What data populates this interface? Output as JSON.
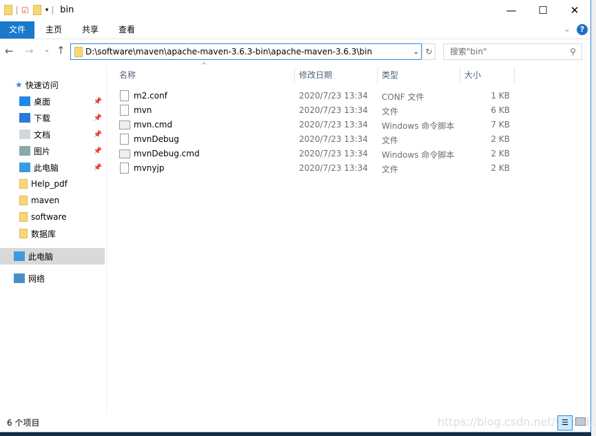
{
  "window": {
    "title": "bin"
  },
  "ribbon": {
    "tabs": [
      "文件",
      "主页",
      "共享",
      "查看"
    ]
  },
  "address": {
    "path": "D:\\software\\maven\\apache-maven-3.6.3-bin\\apache-maven-3.6.3\\bin",
    "search_placeholder": "搜索\"bin\""
  },
  "sidebar": {
    "quick_access": "快速访问",
    "items": [
      {
        "label": "桌面",
        "icon": "desktop-icon",
        "pinned": true,
        "color": "#1e88e5"
      },
      {
        "label": "下载",
        "icon": "download-icon",
        "pinned": true,
        "color": "#2a7bd5"
      },
      {
        "label": "文档",
        "icon": "document-icon",
        "pinned": true,
        "color": "#cfd8dc"
      },
      {
        "label": "图片",
        "icon": "pictures-icon",
        "pinned": true,
        "color": "#8aa"
      },
      {
        "label": "此电脑",
        "icon": "computer-icon",
        "pinned": true,
        "color": "#3b9ae1"
      },
      {
        "label": "Help_pdf",
        "icon": "folder-icon",
        "pinned": false,
        "color": "#f8d775"
      },
      {
        "label": "maven",
        "icon": "folder-icon",
        "pinned": false,
        "color": "#f8d775"
      },
      {
        "label": "software",
        "icon": "folder-icon",
        "pinned": false,
        "color": "#f8d775"
      },
      {
        "label": "数据库",
        "icon": "folder-icon",
        "pinned": false,
        "color": "#f8d775"
      }
    ],
    "this_pc": "此电脑",
    "network": "网络"
  },
  "columns": [
    "名称",
    "修改日期",
    "类型",
    "大小"
  ],
  "files": [
    {
      "name": "m2.conf",
      "date": "2020/7/23 13:34",
      "type": "CONF 文件",
      "size": "1 KB",
      "icon": "file-icon"
    },
    {
      "name": "mvn",
      "date": "2020/7/23 13:34",
      "type": "文件",
      "size": "6 KB",
      "icon": "file-icon"
    },
    {
      "name": "mvn.cmd",
      "date": "2020/7/23 13:34",
      "type": "Windows 命令脚本",
      "size": "7 KB",
      "icon": "cmd-icon"
    },
    {
      "name": "mvnDebug",
      "date": "2020/7/23 13:34",
      "type": "文件",
      "size": "2 KB",
      "icon": "file-icon"
    },
    {
      "name": "mvnDebug.cmd",
      "date": "2020/7/23 13:34",
      "type": "Windows 命令脚本",
      "size": "2 KB",
      "icon": "cmd-icon"
    },
    {
      "name": "mvnyjp",
      "date": "2020/7/23 13:34",
      "type": "文件",
      "size": "2 KB",
      "icon": "file-icon"
    }
  ],
  "status": {
    "count": "6 个项目"
  },
  "watermark": "https://blog.csdn.net/wdord..."
}
